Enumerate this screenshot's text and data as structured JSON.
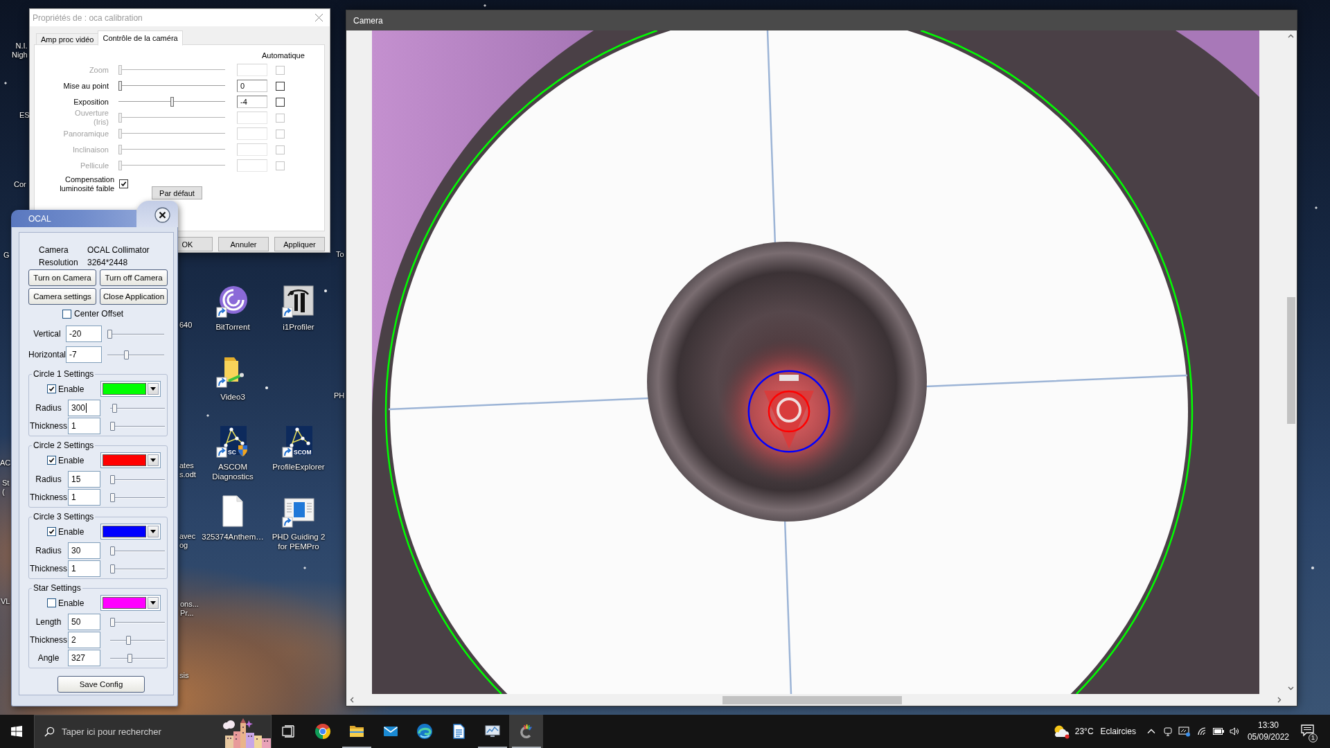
{
  "desktop": {
    "icons": [
      {
        "label": "BitTorrent",
        "kind": "swirl",
        "shortcut": true
      },
      {
        "label": "i1Profiler",
        "kind": "monogram",
        "shortcut": true
      },
      {
        "label": "Video3",
        "kind": "folder",
        "shortcut": true
      },
      {
        "label": "ASCOM Diagnostics",
        "kind": "constellation",
        "shortcut": true,
        "shield": true,
        "logo_text": "SC"
      },
      {
        "label": "ProfileExplorer",
        "kind": "constellation",
        "shortcut": true,
        "shield": false,
        "logo_text": "SCOM"
      },
      {
        "label": "325374Anthem…",
        "kind": "document",
        "shortcut": false
      },
      {
        "label": "PHD Guiding 2 for PEMPro",
        "kind": "window",
        "shortcut": true
      }
    ],
    "cut_off_labels": [
      {
        "lines": [
          "N.I.",
          "Nigh"
        ]
      },
      {
        "lines": [
          "ES"
        ]
      },
      {
        "lines": [
          "Cor"
        ]
      },
      {
        "lines": [
          "G"
        ]
      },
      {
        "lines": [
          "AC"
        ]
      },
      {
        "lines": [
          "St",
          "("
        ]
      },
      {
        "lines": [
          "VL"
        ]
      },
      {
        "lines": [
          "640"
        ]
      },
      {
        "lines": [
          "ates",
          "s.odt"
        ]
      },
      {
        "lines": [
          "avec",
          "og"
        ]
      },
      {
        "lines": [
          "ons...",
          "Pr..."
        ]
      },
      {
        "lines": [
          "sis"
        ]
      },
      {
        "lines": [
          "To"
        ]
      },
      {
        "lines": [
          "PH"
        ]
      }
    ]
  },
  "properties_dialog": {
    "title": "Propriétés de : oca calibration",
    "tabs": [
      {
        "label": "Amp proc vidéo",
        "selected": false
      },
      {
        "label": "Contrôle de la caméra",
        "selected": true
      }
    ],
    "auto_heading": "Automatique",
    "controls": [
      {
        "label": "Zoom",
        "disabled": true,
        "level": 0,
        "auto": false
      },
      {
        "label": "Mise au point",
        "disabled": false,
        "level": 0,
        "value": "0",
        "auto": false
      },
      {
        "label": "Exposition",
        "disabled": false,
        "level": 0.5,
        "value": "-4",
        "auto": false
      },
      {
        "label": "Ouverture (Iris)",
        "disabled": true,
        "level": 0,
        "auto": false
      },
      {
        "label": "Panoramique",
        "disabled": true,
        "level": 0,
        "auto": false
      },
      {
        "label": "Inclinaison",
        "disabled": true,
        "level": 0,
        "auto": false
      },
      {
        "label": "Pellicule",
        "disabled": true,
        "level": 0,
        "auto": false
      }
    ],
    "low_light_compensation": {
      "label": "Compensation luminosité faible",
      "checked": true
    },
    "default_button": "Par défaut",
    "buttons": [
      "OK",
      "Annuler",
      "Appliquer"
    ]
  },
  "ocal_panel": {
    "title": "OCAL",
    "info": [
      {
        "label": "Camera",
        "value": "OCAL Collimator"
      },
      {
        "label": "Resolution",
        "value": "3264*2448"
      }
    ],
    "buttons": [
      "Turn on Camera",
      "Turn off Camera",
      "Camera settings",
      "Close Application"
    ],
    "center_offset": {
      "label": "Center Offset",
      "checked": false
    },
    "offsets": [
      {
        "label": "Vertical",
        "value": "-20",
        "level": 0
      },
      {
        "label": "Horizontal",
        "value": "-7",
        "level": 0.32
      }
    ],
    "groups": [
      {
        "kind": "circle",
        "title": "Circle 1 Settings",
        "enable_label": "Enable",
        "enabled": true,
        "color": "#00ff00",
        "fields": [
          {
            "label": "Radius",
            "value": "300",
            "level": 0.04,
            "focused": true
          },
          {
            "label": "Thickness",
            "value": "1",
            "level": 0,
            "focused": false
          }
        ]
      },
      {
        "kind": "circle",
        "title": "Circle 2 Settings",
        "enable_label": "Enable",
        "enabled": true,
        "color": "#ff0000",
        "fields": [
          {
            "label": "Radius",
            "value": "15",
            "level": 0,
            "focused": false
          },
          {
            "label": "Thickness",
            "value": "1",
            "level": 0,
            "focused": false
          }
        ]
      },
      {
        "kind": "circle",
        "title": "Circle 3 Settings",
        "enable_label": "Enable",
        "enabled": true,
        "color": "#0000ff",
        "fields": [
          {
            "label": "Radius",
            "value": "30",
            "level": 0,
            "focused": false
          },
          {
            "label": "Thickness",
            "value": "1",
            "level": 0,
            "focused": false
          }
        ]
      },
      {
        "kind": "star",
        "title": "Star Settings",
        "enable_label": "Enable",
        "enabled": false,
        "color": "#ff00ff",
        "fields": [
          {
            "label": "Length",
            "value": "50",
            "level": 0,
            "focused": false
          },
          {
            "label": "Thickness",
            "value": "2",
            "level": 0.32,
            "focused": false
          },
          {
            "label": "Angle",
            "value": "327",
            "level": 0.35,
            "focused": false
          }
        ]
      }
    ],
    "save_button": "Save Config"
  },
  "camera_window": {
    "title": "Camera"
  },
  "taskbar": {
    "search": {
      "placeholder": "Taper ici pour rechercher"
    },
    "apps": [
      {
        "kind": "browser",
        "running": false,
        "selected": false
      },
      {
        "kind": "folder",
        "running": true,
        "selected": false
      },
      {
        "kind": "envelope",
        "running": false,
        "selected": false
      },
      {
        "kind": "wave",
        "running": false,
        "selected": false
      },
      {
        "kind": "document",
        "running": false,
        "selected": false
      },
      {
        "kind": "monitor",
        "running": true,
        "selected": false
      },
      {
        "kind": "brush",
        "running": true,
        "selected": true
      }
    ],
    "weather": {
      "temperature": "23°C",
      "condition": "Eclaircies"
    },
    "clock": {
      "time": "13:30",
      "date": "05/09/2022"
    },
    "notification_count": "1"
  }
}
